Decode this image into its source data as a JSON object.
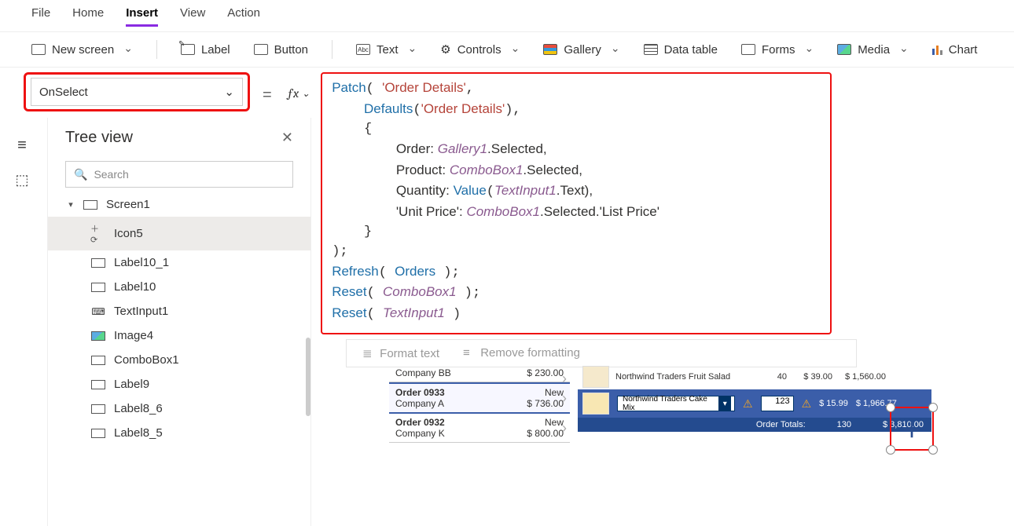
{
  "menu": {
    "file": "File",
    "home": "Home",
    "insert": "Insert",
    "view": "View",
    "action": "Action"
  },
  "ribbon": {
    "new_screen": "New screen",
    "label": "Label",
    "button": "Button",
    "text": "Text",
    "controls": "Controls",
    "gallery": "Gallery",
    "data_table": "Data table",
    "forms": "Forms",
    "media": "Media",
    "chart": "Chart"
  },
  "property_selector": "OnSelect",
  "formula": {
    "l1a": "Patch",
    "l1b": "'Order Details'",
    "l2a": "Defaults",
    "l2b": "'Order Details'",
    "l4a": "Order: ",
    "l4b": "Gallery1",
    "l4c": ".Selected,",
    "l5a": "Product: ",
    "l5b": "ComboBox1",
    "l5c": ".Selected,",
    "l6a": "Quantity: ",
    "l6b": "Value",
    "l6c": "TextInput1",
    "l6d": ".Text),",
    "l7a": "'Unit Price': ",
    "l7b": "ComboBox1",
    "l7c": ".Selected.'List Price'",
    "l10a": "Refresh",
    "l10b": "Orders",
    "l11a": "Reset",
    "l11b": "ComboBox1",
    "l12a": "Reset",
    "l12b": "TextInput1"
  },
  "format_bar": {
    "format": "Format text",
    "remove": "Remove formatting"
  },
  "tree": {
    "title": "Tree view",
    "search_placeholder": "Search",
    "items": [
      {
        "label": "Screen1"
      },
      {
        "label": "Icon5"
      },
      {
        "label": "Label10_1"
      },
      {
        "label": "Label10"
      },
      {
        "label": "TextInput1"
      },
      {
        "label": "Image4"
      },
      {
        "label": "ComboBox1"
      },
      {
        "label": "Label9"
      },
      {
        "label": "Label8_6"
      },
      {
        "label": "Label8_5"
      }
    ]
  },
  "orders": [
    {
      "name": "Company BB",
      "amount": "$ 230.00"
    },
    {
      "order": "Order 0933",
      "name": "Company A",
      "status": "New",
      "amount": "$ 736.00",
      "selected": true
    },
    {
      "order": "Order 0932",
      "name": "Company K",
      "status": "New",
      "amount": "$ 800.00"
    }
  ],
  "detail_rows": [
    {
      "product": "Northwind Traders Fruit Salad",
      "qty": "40",
      "price": "$ 39.00",
      "ext": "$ 1,560.00"
    }
  ],
  "new_line": {
    "product": "Northwind Traders Cake Mix",
    "qty": "123",
    "price": "$ 15.99",
    "ext": "$ 1,966.77"
  },
  "totals": {
    "label": "Order Totals:",
    "qty": "130",
    "amount": "$ 3,810.00"
  }
}
